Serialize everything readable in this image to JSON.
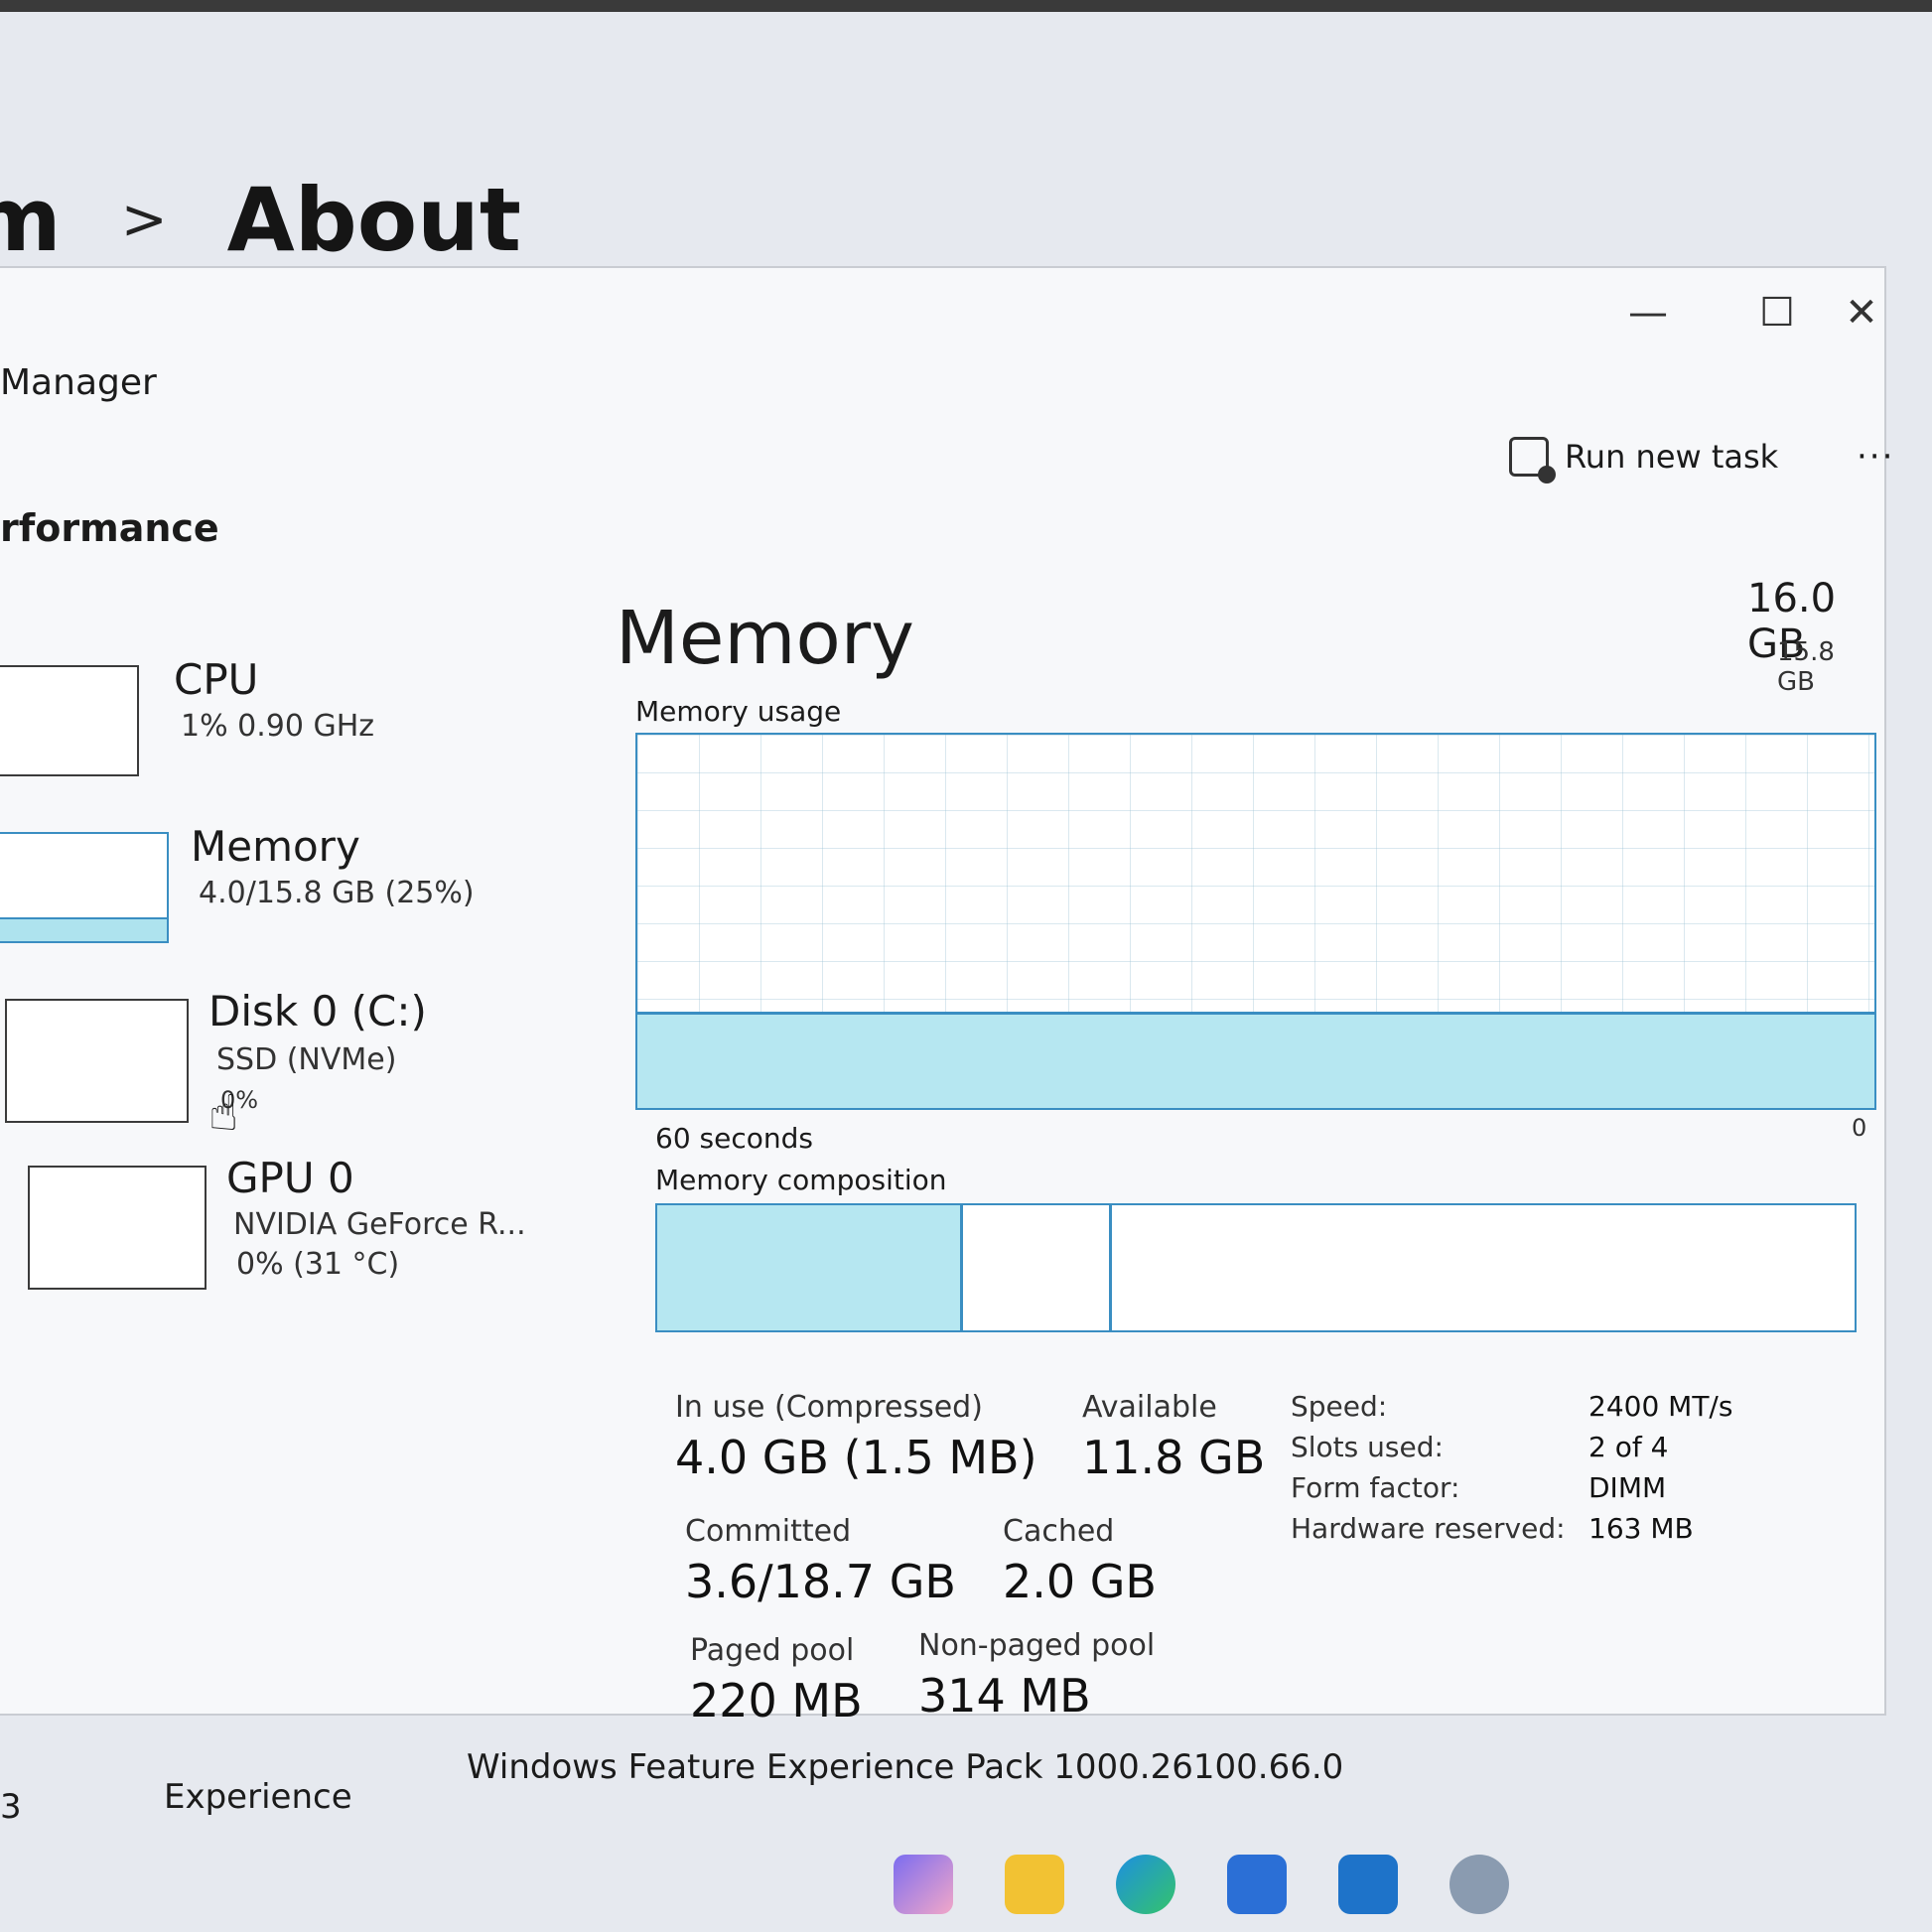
{
  "settings": {
    "breadcrumb_prev": "m",
    "breadcrumb_sep": ">",
    "breadcrumb_current": "About",
    "experience_label": "Experience",
    "experience_value": "Windows Feature Experience Pack 1000.26100.66.0",
    "left_fragment": "3"
  },
  "window": {
    "title": "Manager",
    "minimize": "—",
    "maximize": "☐",
    "close": "✕",
    "section": "rformance",
    "run_task_label": "Run new task",
    "more_label": "···"
  },
  "sidebar": {
    "items": [
      {
        "name": "CPU",
        "sub1": "1% 0.90 GHz",
        "sub2": ""
      },
      {
        "name": "Memory",
        "sub1": "4.0/15.8 GB (25%)",
        "sub2": ""
      },
      {
        "name": "Disk 0 (C:)",
        "sub1": "SSD (NVMe)",
        "sub2": "0%"
      },
      {
        "name": "GPU 0",
        "sub1": "NVIDIA GeForce R...",
        "sub2": "0% (31 °C)"
      }
    ]
  },
  "memory": {
    "title": "Memory",
    "total": "16.0 GB",
    "graph_max": "15.8 GB",
    "usage_label": "Memory usage",
    "usage_fraction": 0.25,
    "graph_min": "0",
    "time_label": "60 seconds",
    "composition_label": "Memory composition",
    "stats": {
      "in_use_label": "In use (Compressed)",
      "in_use_value": "4.0 GB (1.5 MB)",
      "available_label": "Available",
      "available_value": "11.8 GB",
      "committed_label": "Committed",
      "committed_value": "3.6/18.7 GB",
      "cached_label": "Cached",
      "cached_value": "2.0 GB",
      "paged_label": "Paged pool",
      "paged_value": "220 MB",
      "nonpaged_label": "Non-paged pool",
      "nonpaged_value": "314 MB"
    },
    "specs": [
      {
        "k": "Speed:",
        "v": "2400 MT/s"
      },
      {
        "k": "Slots used:",
        "v": "2 of 4"
      },
      {
        "k": "Form factor:",
        "v": "DIMM"
      },
      {
        "k": "Hardware reserved:",
        "v": "163 MB"
      }
    ]
  },
  "colors": {
    "accent": "#3a8ec2",
    "fill": "#b6e7f1"
  },
  "taskbar": {
    "icons": [
      "copilot-icon",
      "file-explorer-icon",
      "edge-icon",
      "store-icon",
      "task-manager-icon",
      "settings-icon"
    ]
  }
}
